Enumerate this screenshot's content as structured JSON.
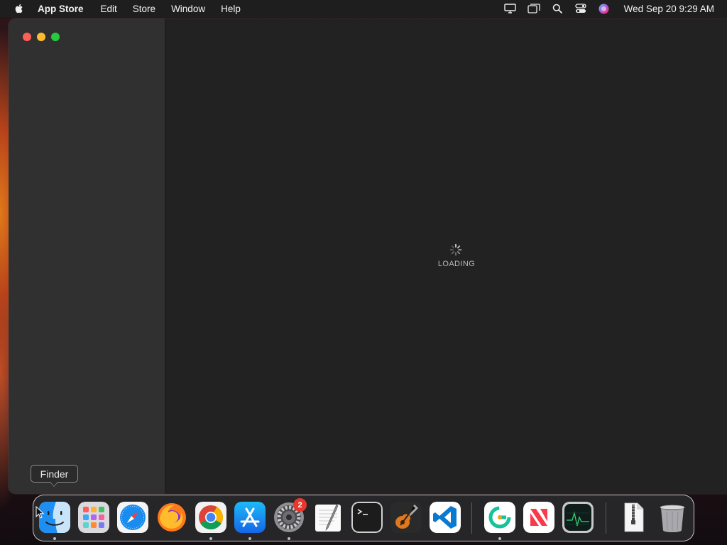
{
  "menubar": {
    "app_name": "App Store",
    "items": [
      "Edit",
      "Store",
      "Window",
      "Help"
    ],
    "clock": "Wed Sep 20  9:29 AM",
    "status_icons": [
      "display-icon",
      "window-stack-icon",
      "spotlight-icon",
      "control-center-icon",
      "siri-icon"
    ]
  },
  "window": {
    "loading_label": "LOADING"
  },
  "tooltip": {
    "label": "Finder"
  },
  "dock": {
    "apps": [
      {
        "name": "Finder",
        "icon": "finder-icon",
        "running": true
      },
      {
        "name": "Launchpad",
        "icon": "launchpad-icon",
        "running": false
      },
      {
        "name": "Safari",
        "icon": "safari-icon",
        "running": false
      },
      {
        "name": "Firefox",
        "icon": "firefox-icon",
        "running": false
      },
      {
        "name": "Google Chrome",
        "icon": "chrome-icon",
        "running": true
      },
      {
        "name": "App Store",
        "icon": "app-store-icon",
        "running": true
      },
      {
        "name": "System Settings",
        "icon": "system-settings-icon",
        "running": true,
        "badge": "2"
      },
      {
        "name": "TextEdit",
        "icon": "textedit-icon",
        "running": false
      },
      {
        "name": "Terminal",
        "icon": "terminal-icon",
        "running": false
      },
      {
        "name": "GarageBand",
        "icon": "garageband-icon",
        "running": false
      },
      {
        "name": "Visual Studio Code",
        "icon": "vscode-icon",
        "running": false
      },
      {
        "name": "Grammarly",
        "icon": "grammarly-icon",
        "running": true
      },
      {
        "name": "News",
        "icon": "news-icon",
        "running": false
      },
      {
        "name": "Activity Monitor",
        "icon": "activity-monitor-icon",
        "running": false
      },
      {
        "name": "Archive",
        "icon": "zip-archive-icon",
        "running": false
      },
      {
        "name": "Trash",
        "icon": "trash-icon",
        "running": false
      }
    ],
    "badge_count": "2"
  },
  "colors": {
    "close": "#ff5f57",
    "minimize": "#febc2e",
    "maximize": "#28c840",
    "badge": "#e8372d"
  }
}
